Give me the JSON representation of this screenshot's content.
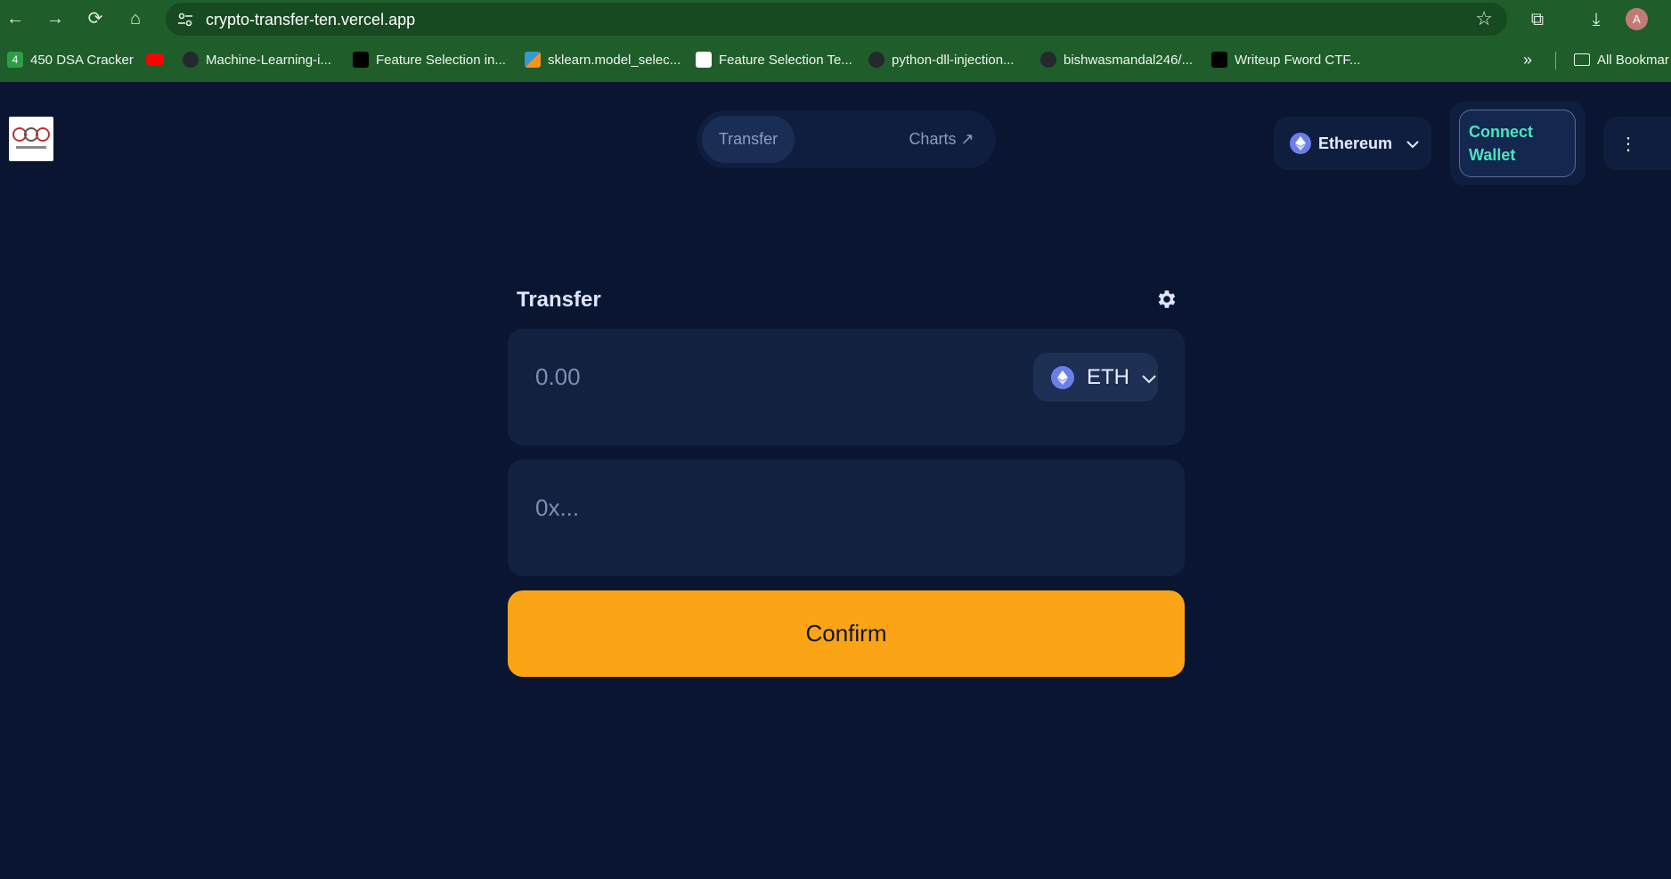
{
  "browser": {
    "url": "crypto-transfer-ten.vercel.app",
    "avatar_letter": "A",
    "bookmarks": [
      {
        "label": "450 DSA Cracker",
        "icon": "450-badge-icon",
        "color": "#2e9d48"
      },
      {
        "label": "",
        "icon": "youtube-icon",
        "color": "#ff0000"
      },
      {
        "label": "Machine-Learning-i...",
        "icon": "github-icon",
        "color": "#24292e"
      },
      {
        "label": "Feature Selection in...",
        "icon": "medium-icon",
        "color": "#000000"
      },
      {
        "label": "sklearn.model_selec...",
        "icon": "sklearn-icon",
        "color": "#f7931e"
      },
      {
        "label": "Feature Selection Te...",
        "icon": "chart-favicon-icon",
        "color": "#ffffff"
      },
      {
        "label": "python-dll-injection...",
        "icon": "github-icon",
        "color": "#24292e"
      },
      {
        "label": "bishwasmandal246/...",
        "icon": "github-icon",
        "color": "#24292e"
      },
      {
        "label": "Writeup Fword CTF...",
        "icon": "medium-icon",
        "color": "#000000"
      }
    ],
    "more_bookmarks": "»",
    "all_bookmarks_label": "All Bookmar"
  },
  "app": {
    "tabs": {
      "transfer": "Transfer",
      "charts": "Charts ↗"
    },
    "network": "Ethereum",
    "connect_wallet": "Connect Wallet",
    "panel_title": "Transfer",
    "amount_placeholder": "0.00",
    "token": "ETH",
    "address_placeholder": "0x...",
    "confirm": "Confirm"
  },
  "colors": {
    "background": "#0a1631",
    "card": "#11213f",
    "accent": "#fba516",
    "connect_text": "#4be6bb",
    "browser_chrome": "#1f5d2a"
  }
}
